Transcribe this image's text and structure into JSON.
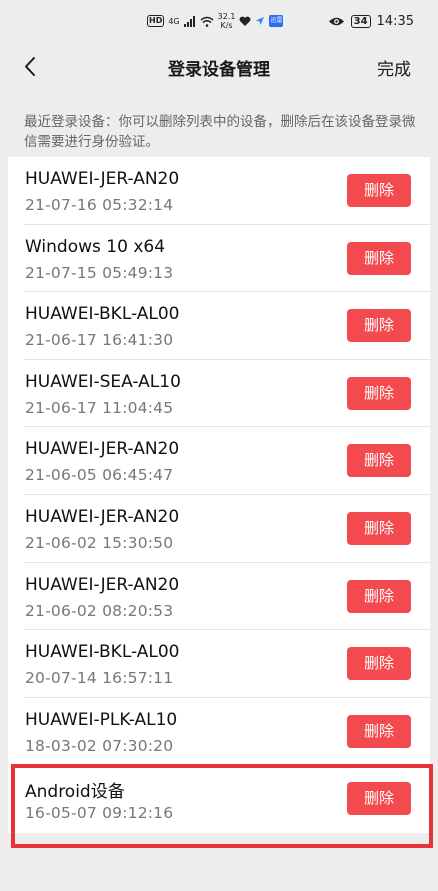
{
  "status_bar": {
    "hd": "HD",
    "net": "4G",
    "speed_value": "32.1",
    "speed_unit": "K/s",
    "app_icon_text": "迅雷",
    "battery": "34",
    "time": "14:35"
  },
  "nav": {
    "title": "登录设备管理",
    "done": "完成"
  },
  "notice": "最近登录设备：你可以删除列表中的设备，删除后在该设备登录微信需要进行身份验证。",
  "delete_label": "删除",
  "devices": [
    {
      "name": "HUAWEI-JER-AN20",
      "time": "21-07-16 05:32:14"
    },
    {
      "name": "Windows 10 x64",
      "time": "21-07-15 05:49:13"
    },
    {
      "name": "HUAWEI-BKL-AL00",
      "time": "21-06-17 16:41:30"
    },
    {
      "name": "HUAWEI-SEA-AL10",
      "time": "21-06-17 11:04:45"
    },
    {
      "name": "HUAWEI-JER-AN20",
      "time": "21-06-05 06:45:47"
    },
    {
      "name": "HUAWEI-JER-AN20",
      "time": "21-06-02 15:30:50"
    },
    {
      "name": "HUAWEI-JER-AN20",
      "time": "21-06-02 08:20:53"
    },
    {
      "name": "HUAWEI-BKL-AL00",
      "time": "20-07-14 16:57:11"
    },
    {
      "name": "HUAWEI-PLK-AL10",
      "time": "18-03-02 07:30:20"
    },
    {
      "name": "Android设备",
      "time": "16-05-07 09:12:16"
    }
  ],
  "colors": {
    "delete_button": "#f24a4f",
    "highlight": "#e8323a",
    "page_background": "#ededed"
  }
}
